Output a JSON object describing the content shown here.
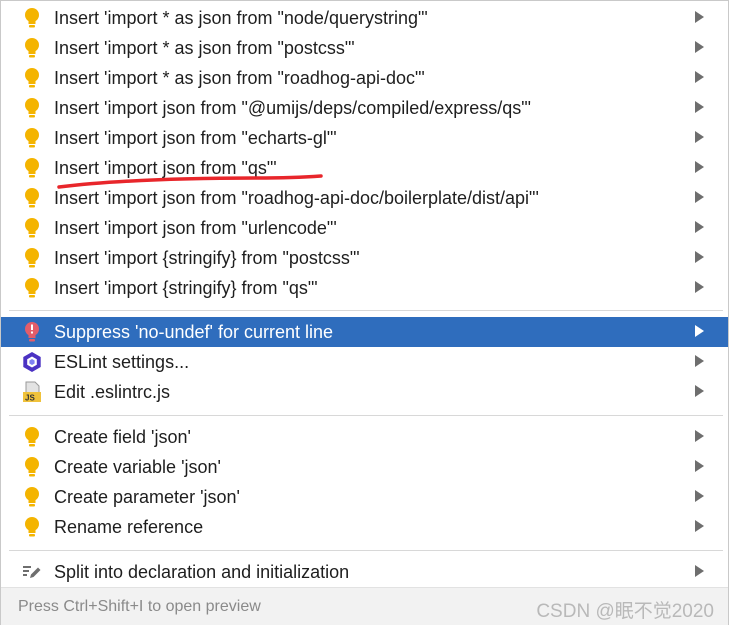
{
  "menu": {
    "group1": [
      {
        "label": "Insert 'import * as json from \"node/querystring\"'",
        "icon": "bulb-icon"
      },
      {
        "label": "Insert 'import * as json from \"postcss\"'",
        "icon": "bulb-icon"
      },
      {
        "label": "Insert 'import * as json from \"roadhog-api-doc\"'",
        "icon": "bulb-icon"
      },
      {
        "label": "Insert 'import json from \"@umijs/deps/compiled/express/qs\"'",
        "icon": "bulb-icon"
      },
      {
        "label": "Insert 'import json from \"echarts-gl\"'",
        "icon": "bulb-icon"
      },
      {
        "label": "Insert 'import json from \"qs\"'",
        "icon": "bulb-icon"
      },
      {
        "label": "Insert 'import json from \"roadhog-api-doc/boilerplate/dist/api\"'",
        "icon": "bulb-icon"
      },
      {
        "label": "Insert 'import json from \"urlencode\"'",
        "icon": "bulb-icon"
      },
      {
        "label": "Insert 'import {stringify} from \"postcss\"'",
        "icon": "bulb-icon"
      },
      {
        "label": "Insert 'import {stringify} from \"qs\"'",
        "icon": "bulb-icon"
      }
    ],
    "group2": [
      {
        "label": "Suppress 'no-undef' for current line",
        "icon": "red-bulb-icon"
      },
      {
        "label": "ESLint settings...",
        "icon": "eslint-icon"
      },
      {
        "label": "Edit .eslintrc.js",
        "icon": "js-file-icon"
      }
    ],
    "group3": [
      {
        "label": "Create field 'json'",
        "icon": "bulb-icon"
      },
      {
        "label": "Create variable 'json'",
        "icon": "bulb-icon"
      },
      {
        "label": "Create parameter 'json'",
        "icon": "bulb-icon"
      },
      {
        "label": "Rename reference",
        "icon": "bulb-icon"
      }
    ],
    "group4": [
      {
        "label": "Split into declaration and initialization",
        "icon": "edit-pencil-icon"
      }
    ]
  },
  "footer": {
    "hint": "Press Ctrl+Shift+I to open preview",
    "watermark": "CSDN @眠不觉2020"
  },
  "colors": {
    "selection": "#2f6dbd",
    "bulb": "#f4b400",
    "annotation_underline": "#e8262b"
  }
}
